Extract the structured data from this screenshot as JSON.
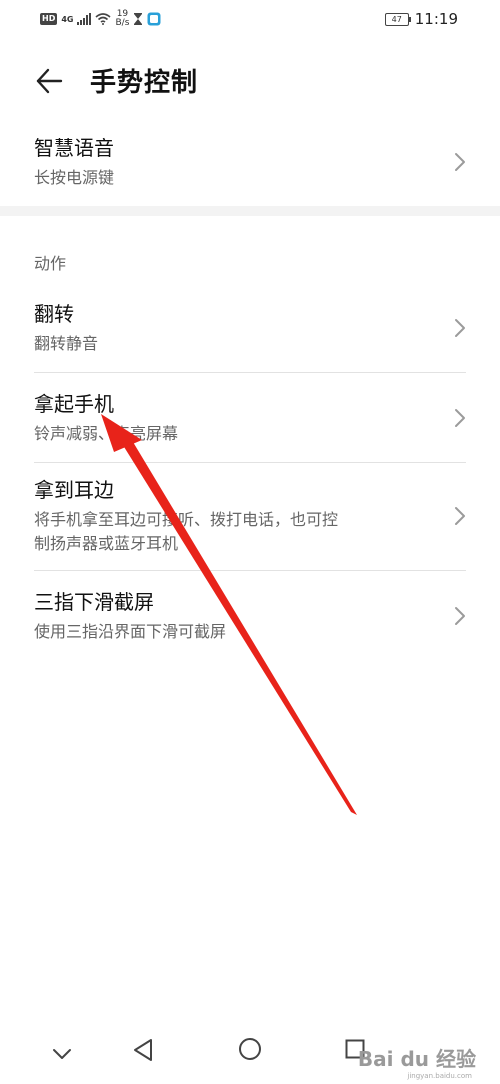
{
  "status_bar": {
    "hd": "HD",
    "network": "4G",
    "speed_value": "19",
    "speed_unit": "B/s",
    "battery": "47",
    "time": "11:19"
  },
  "header": {
    "title": "手势控制"
  },
  "smart_voice": {
    "title": "智慧语音",
    "subtitle": "长按电源键"
  },
  "section": {
    "label": "动作"
  },
  "items": [
    {
      "title": "翻转",
      "subtitle": "翻转静音"
    },
    {
      "title": "拿起手机",
      "subtitle": "铃声减弱、点亮屏幕"
    },
    {
      "title": "拿到耳边",
      "subtitle_line1": "将手机拿至耳边可接听、拨打电话，也可控",
      "subtitle_line2": "制扬声器或蓝牙耳机"
    },
    {
      "title": "三指下滑截屏",
      "subtitle": "使用三指沿界面下滑可截屏"
    }
  ],
  "watermark": {
    "text": "Bai du 经验",
    "sub": "jingyan.baidu.com"
  },
  "colors": {
    "annotation_arrow": "#e8231a",
    "section_band": "#f3f3f3"
  }
}
